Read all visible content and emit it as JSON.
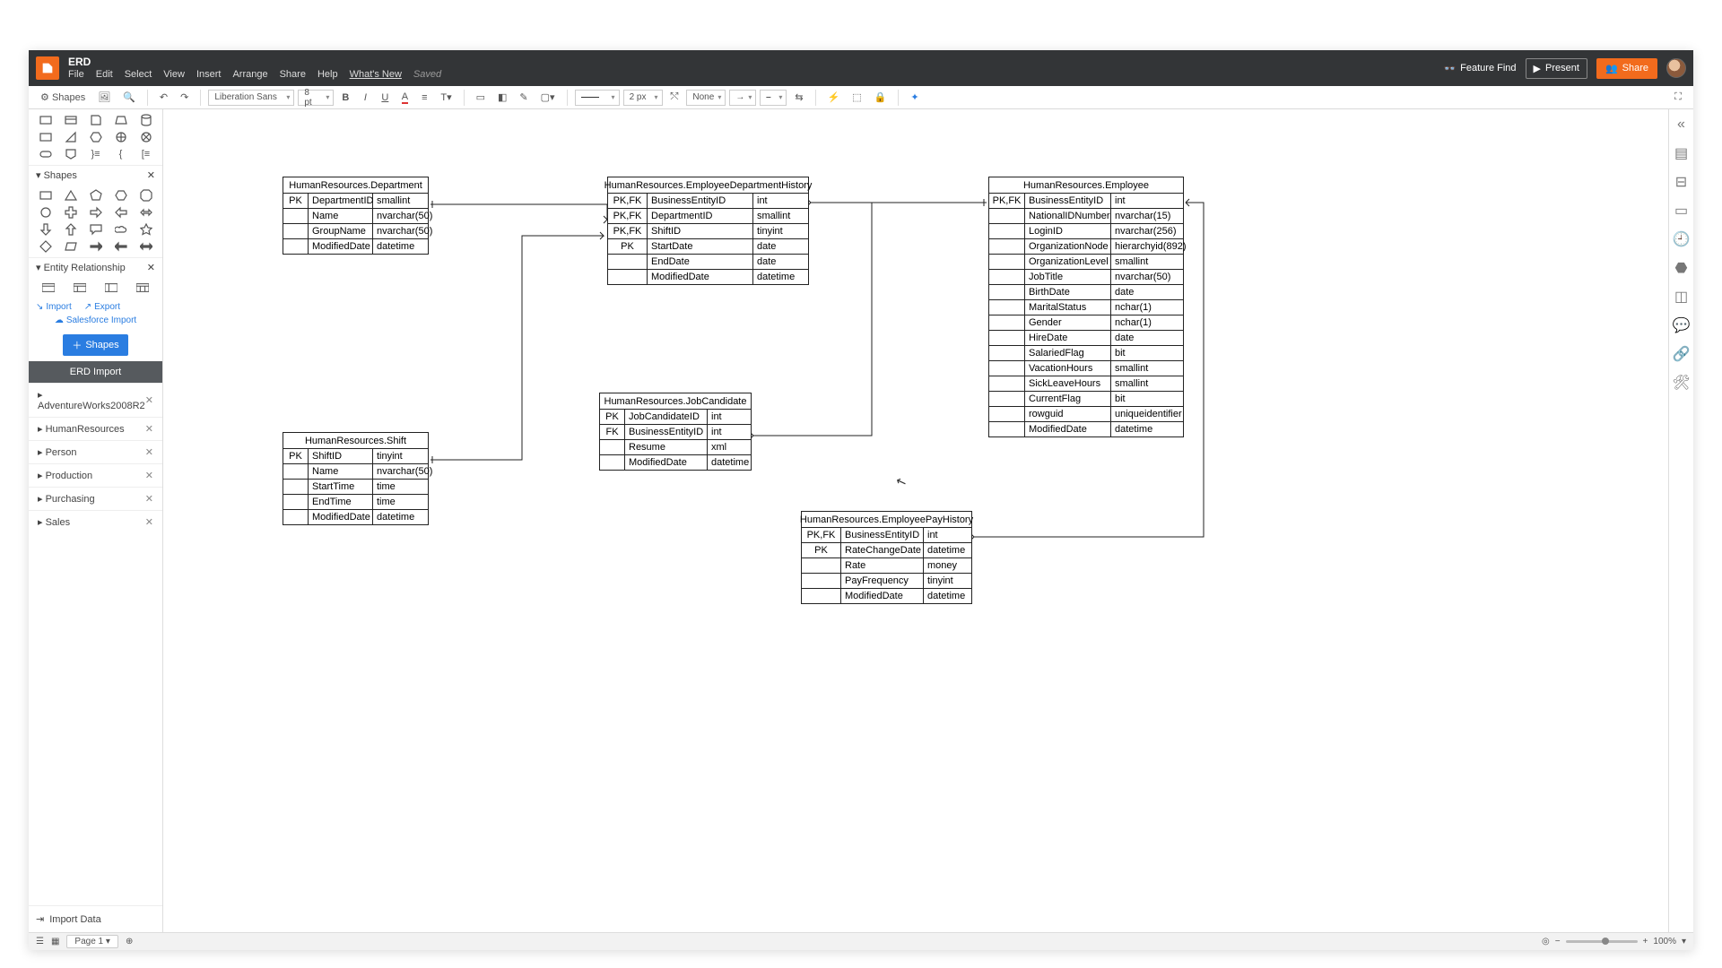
{
  "header": {
    "title": "ERD",
    "menus": [
      "File",
      "Edit",
      "Select",
      "View",
      "Insert",
      "Arrange",
      "Share",
      "Help"
    ],
    "whats_new": "What's New",
    "saved": "Saved",
    "feature_find": "Feature Find",
    "present": "Present",
    "share": "Share"
  },
  "toolbar": {
    "shapes": "Shapes",
    "font": "Liberation Sans",
    "font_size": "8 pt",
    "stroke_width": "2 px",
    "line_end_none": "None"
  },
  "left": {
    "shapes_header": "Shapes",
    "sect_shapes": "Shapes",
    "sect_er": "Entity Relationship",
    "import": "Import",
    "export": "Export",
    "sf": "Salesforce Import",
    "btn_shapes": "Shapes",
    "erd_import": "ERD Import",
    "datasets": [
      "AdventureWorks2008R2",
      "HumanResources",
      "Person",
      "Production",
      "Purchasing",
      "Sales"
    ],
    "import_data": "Import Data"
  },
  "footer": {
    "page": "Page 1",
    "zoom": "100%"
  },
  "tables": {
    "dept": {
      "title": "HumanResources.Department",
      "rows": [
        {
          "k": "PK",
          "n": "DepartmentID",
          "t": "smallint"
        },
        {
          "k": "",
          "n": "Name",
          "t": "nvarchar(50)"
        },
        {
          "k": "",
          "n": "GroupName",
          "t": "nvarchar(50)"
        },
        {
          "k": "",
          "n": "ModifiedDate",
          "t": "datetime"
        }
      ]
    },
    "edh": {
      "title": "HumanResources.EmployeeDepartmentHistory",
      "rows": [
        {
          "k": "PK,FK",
          "n": "BusinessEntityID",
          "t": "int"
        },
        {
          "k": "PK,FK",
          "n": "DepartmentID",
          "t": "smallint"
        },
        {
          "k": "PK,FK",
          "n": "ShiftID",
          "t": "tinyint"
        },
        {
          "k": "PK",
          "n": "StartDate",
          "t": "date"
        },
        {
          "k": "",
          "n": "EndDate",
          "t": "date"
        },
        {
          "k": "",
          "n": "ModifiedDate",
          "t": "datetime"
        }
      ]
    },
    "emp": {
      "title": "HumanResources.Employee",
      "rows": [
        {
          "k": "PK,FK",
          "n": "BusinessEntityID",
          "t": "int"
        },
        {
          "k": "",
          "n": "NationalIDNumber",
          "t": "nvarchar(15)"
        },
        {
          "k": "",
          "n": "LoginID",
          "t": "nvarchar(256)"
        },
        {
          "k": "",
          "n": "OrganizationNode",
          "t": "hierarchyid(892)"
        },
        {
          "k": "",
          "n": "OrganizationLevel",
          "t": "smallint"
        },
        {
          "k": "",
          "n": "JobTitle",
          "t": "nvarchar(50)"
        },
        {
          "k": "",
          "n": "BirthDate",
          "t": "date"
        },
        {
          "k": "",
          "n": "MaritalStatus",
          "t": "nchar(1)"
        },
        {
          "k": "",
          "n": "Gender",
          "t": "nchar(1)"
        },
        {
          "k": "",
          "n": "HireDate",
          "t": "date"
        },
        {
          "k": "",
          "n": "SalariedFlag",
          "t": "bit"
        },
        {
          "k": "",
          "n": "VacationHours",
          "t": "smallint"
        },
        {
          "k": "",
          "n": "SickLeaveHours",
          "t": "smallint"
        },
        {
          "k": "",
          "n": "CurrentFlag",
          "t": "bit"
        },
        {
          "k": "",
          "n": "rowguid",
          "t": "uniqueidentifier"
        },
        {
          "k": "",
          "n": "ModifiedDate",
          "t": "datetime"
        }
      ]
    },
    "shift": {
      "title": "HumanResources.Shift",
      "rows": [
        {
          "k": "PK",
          "n": "ShiftID",
          "t": "tinyint"
        },
        {
          "k": "",
          "n": "Name",
          "t": "nvarchar(50)"
        },
        {
          "k": "",
          "n": "StartTime",
          "t": "time"
        },
        {
          "k": "",
          "n": "EndTime",
          "t": "time"
        },
        {
          "k": "",
          "n": "ModifiedDate",
          "t": "datetime"
        }
      ]
    },
    "job": {
      "title": "HumanResources.JobCandidate",
      "rows": [
        {
          "k": "PK",
          "n": "JobCandidateID",
          "t": "int"
        },
        {
          "k": "FK",
          "n": "BusinessEntityID",
          "t": "int"
        },
        {
          "k": "",
          "n": "Resume",
          "t": "xml"
        },
        {
          "k": "",
          "n": "ModifiedDate",
          "t": "datetime"
        }
      ]
    },
    "pay": {
      "title": "HumanResources.EmployeePayHistory",
      "rows": [
        {
          "k": "PK,FK",
          "n": "BusinessEntityID",
          "t": "int"
        },
        {
          "k": "PK",
          "n": "RateChangeDate",
          "t": "datetime"
        },
        {
          "k": "",
          "n": "Rate",
          "t": "money"
        },
        {
          "k": "",
          "n": "PayFrequency",
          "t": "tinyint"
        },
        {
          "k": "",
          "n": "ModifiedDate",
          "t": "datetime"
        }
      ]
    }
  }
}
